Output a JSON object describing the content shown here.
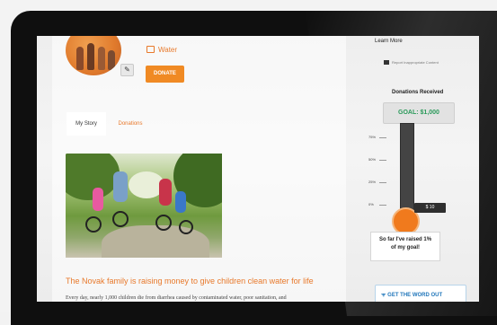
{
  "campaign": {
    "cause_label": "Water",
    "donate_label": "DONATE",
    "tabs": [
      {
        "label": "My Story",
        "active": true
      },
      {
        "label": "Donations",
        "active": false
      }
    ],
    "story_title": "The Novak family is raising money to give children clean water for life",
    "story_text": "Every day, nearly 1,000 children die from diarrhea caused by contaminated water, poor sanitation, and"
  },
  "sidebar": {
    "learn_more": "Learn More",
    "report_label": "Report Inappropriate Content",
    "donations_received": "Donations Received",
    "goal_label": "GOAL: $1,000",
    "percent_labels": [
      "75%",
      "50%",
      "25%",
      "0%"
    ],
    "amount_raised": "$ 10",
    "raised_line1": "So far I've raised 1%",
    "raised_line2": "of my goal!",
    "progress_percent": 1,
    "share_label": "GET THE WORD OUT"
  },
  "colors": {
    "accent": "#f08a24",
    "goal_green": "#2a9a5a",
    "share_blue": "#2277bb"
  },
  "icons": [
    "pencil-icon",
    "calendar-icon",
    "flag-icon",
    "rss-icon"
  ]
}
